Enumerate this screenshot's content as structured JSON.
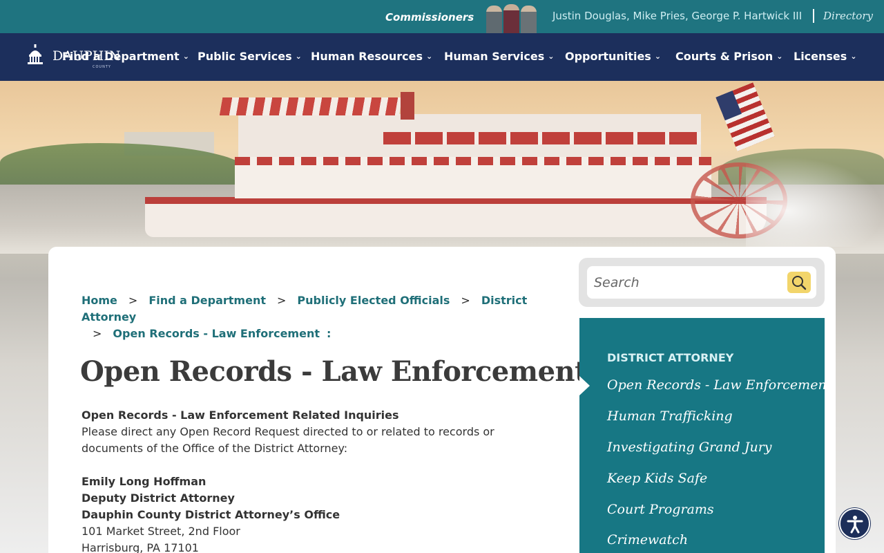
{
  "topbar": {
    "commissioners_label": "Commissioners",
    "commissioners_names": "Justin Douglas, Mike Pries, George P. Hartwick III",
    "directory_label": "Directory"
  },
  "logo": {
    "name": "DAUPHIN",
    "sub": "COUNTY"
  },
  "nav": {
    "items": [
      {
        "label": "Find a Department"
      },
      {
        "label": "Public Services"
      },
      {
        "label": "Human Resources"
      },
      {
        "label": "Human Services"
      },
      {
        "label": "Opportunities"
      },
      {
        "label": "Courts & Prison"
      },
      {
        "label": "Licenses"
      }
    ]
  },
  "breadcrumb": {
    "items": [
      "Home",
      "Find a Department",
      "Publicly Elected Officials",
      "District Attorney",
      "Open Records - Law Enforcement"
    ],
    "separator": ">",
    "trailing": ":"
  },
  "page": {
    "title": "Open Records - Law Enforcement",
    "intro_heading": "Open Records - Law Enforcement Related Inquiries",
    "intro_text": "Please direct any Open Record Request directed to or related to records or documents of the Office of the District Attorney:",
    "contact_name": "Emily Long Hoffman",
    "contact_title": "Deputy District Attorney",
    "contact_office": "Dauphin County District Attorney’s Office",
    "address_line1": "101 Market Street, 2nd Floor",
    "address_line2": "Harrisburg, PA 17101"
  },
  "search": {
    "placeholder": "Search"
  },
  "sidenav": {
    "heading": "DISTRICT ATTORNEY",
    "items": [
      {
        "label": "Open Records - Law Enforcement",
        "active": true
      },
      {
        "label": "Human Trafficking"
      },
      {
        "label": "Investigating Grand Jury"
      },
      {
        "label": "Keep Kids Safe"
      },
      {
        "label": "Court Programs"
      },
      {
        "label": "Crimewatch"
      }
    ]
  },
  "colors": {
    "topbar": "#1f7480",
    "nav": "#1c2f5c",
    "link": "#1f6f78",
    "sidenav": "#177784",
    "search_button": "#f2d56b"
  },
  "icons": {
    "logo": "capitol-dome-icon",
    "search": "search-icon",
    "accessibility": "accessibility-icon",
    "dropdown": "chevron-down-icon"
  }
}
